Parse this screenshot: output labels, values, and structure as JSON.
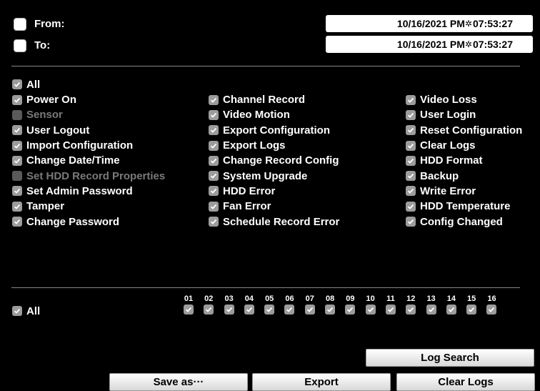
{
  "time_range": {
    "from_label": "From:",
    "to_label": "To:",
    "from_value": "10/16/2021 PM ",
    "from_time": "07:53:27",
    "to_value": "10/16/2021 PM ",
    "to_time": "07:53:27"
  },
  "events": {
    "all_label": "All",
    "columns": [
      [
        {
          "label": "Power On",
          "checked": true,
          "enabled": true
        },
        {
          "label": "Sensor",
          "checked": false,
          "enabled": false
        },
        {
          "label": "User Logout",
          "checked": true,
          "enabled": true
        },
        {
          "label": "Import Configuration",
          "checked": true,
          "enabled": true
        },
        {
          "label": "Change Date/Time",
          "checked": true,
          "enabled": true
        },
        {
          "label": "Set HDD Record Properties",
          "checked": false,
          "enabled": false
        },
        {
          "label": "Set Admin Password",
          "checked": true,
          "enabled": true
        },
        {
          "label": "Tamper",
          "checked": true,
          "enabled": true
        },
        {
          "label": "Change Password",
          "checked": true,
          "enabled": true
        }
      ],
      [
        {
          "label": "Channel Record",
          "checked": true,
          "enabled": true
        },
        {
          "label": "Video Motion",
          "checked": true,
          "enabled": true
        },
        {
          "label": "Export Configuration",
          "checked": true,
          "enabled": true
        },
        {
          "label": "Export Logs",
          "checked": true,
          "enabled": true
        },
        {
          "label": "Change Record Config",
          "checked": true,
          "enabled": true
        },
        {
          "label": "System Upgrade",
          "checked": true,
          "enabled": true
        },
        {
          "label": "HDD Error",
          "checked": true,
          "enabled": true
        },
        {
          "label": "Fan Error",
          "checked": true,
          "enabled": true
        },
        {
          "label": "Schedule Record Error",
          "checked": true,
          "enabled": true
        }
      ],
      [
        {
          "label": "Video Loss",
          "checked": true,
          "enabled": true
        },
        {
          "label": "User Login",
          "checked": true,
          "enabled": true
        },
        {
          "label": "Reset Configuration",
          "checked": true,
          "enabled": true
        },
        {
          "label": "Clear Logs",
          "checked": true,
          "enabled": true
        },
        {
          "label": "HDD Format",
          "checked": true,
          "enabled": true
        },
        {
          "label": "Backup",
          "checked": true,
          "enabled": true
        },
        {
          "label": "Write Error",
          "checked": true,
          "enabled": true
        },
        {
          "label": "HDD Temperature",
          "checked": true,
          "enabled": true
        },
        {
          "label": "Config Changed",
          "checked": true,
          "enabled": true
        }
      ]
    ]
  },
  "channels": {
    "all_label": "All",
    "list": [
      "01",
      "02",
      "03",
      "04",
      "05",
      "06",
      "07",
      "08",
      "09",
      "10",
      "11",
      "12",
      "13",
      "14",
      "15",
      "16"
    ]
  },
  "buttons": {
    "log_search": "Log Search",
    "save_as": "Save as···",
    "export": "Export",
    "clear_logs": "Clear Logs"
  }
}
